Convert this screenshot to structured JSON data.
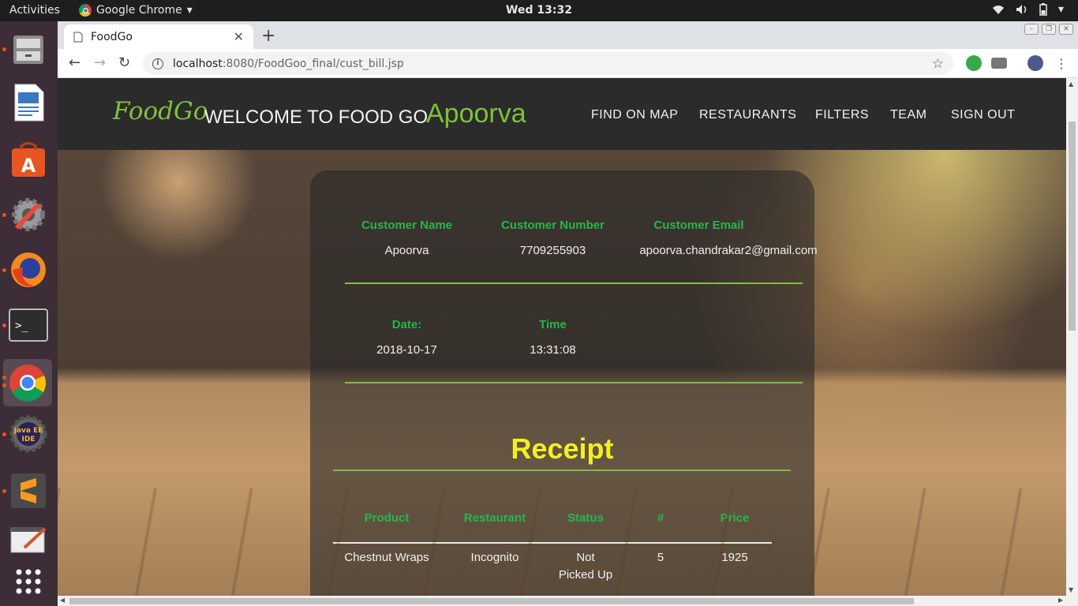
{
  "os": {
    "activities": "Activities",
    "app_name": "Google Chrome",
    "clock": "Wed 13:32"
  },
  "browser": {
    "tab_title": "FoodGo",
    "url_host": "localhost",
    "url_path": ":8080/FoodGoo_final/cust_bill.jsp"
  },
  "page": {
    "brand": "FoodGo",
    "welcome": "WELCOME TO FOOD GO",
    "user": "Apoorva",
    "nav": [
      "FIND ON MAP",
      "RESTAURANTS",
      "FILTERS",
      "TEAM",
      "SIGN OUT"
    ],
    "customer": {
      "name_label": "Customer Name",
      "number_label": "Customer Number",
      "email_label": "Customer Email",
      "name": "Apoorva",
      "number": "7709255903",
      "email": "apoorva.chandrakar2@gmail.com"
    },
    "datetime": {
      "date_label": "Date:",
      "time_label": "Time",
      "date": "2018-10-17",
      "time": "13:31:08"
    },
    "receipt_title": "Receipt",
    "table": {
      "headers": [
        "Product",
        "Restaurant",
        "Status",
        "#",
        "Price"
      ],
      "rows": [
        {
          "product": "Chestnut Wraps",
          "restaurant": "Incognito",
          "status_line1": "Not",
          "status_line2": "Picked Up",
          "qty": "5",
          "price": "1925"
        }
      ]
    }
  },
  "colors": {
    "accent_green": "#7ec13a",
    "label_green": "#27b64b",
    "receipt_yellow": "#f3f022",
    "nav_bg": "#2b2b2b"
  }
}
